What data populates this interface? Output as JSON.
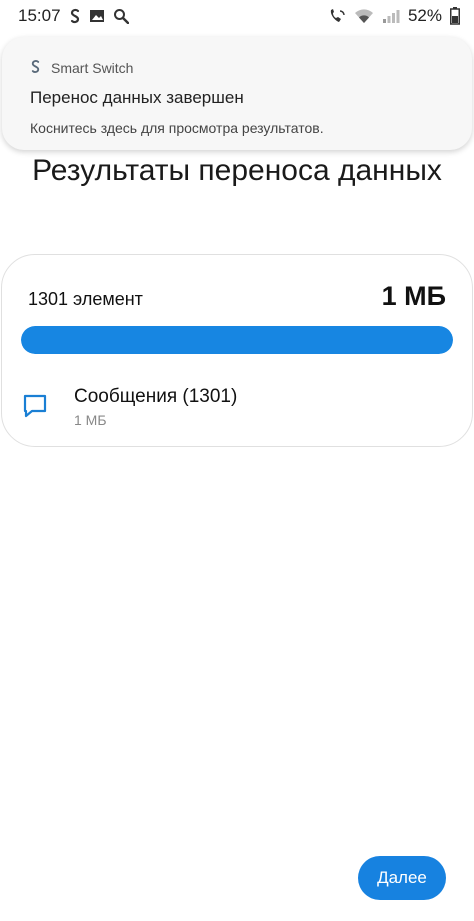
{
  "statusbar": {
    "time": "15:07",
    "battery": "52%",
    "icons": [
      "smart-switch-icon",
      "gallery-icon",
      "search-icon",
      "wifi-call-icon",
      "wifi-icon",
      "signal-icon",
      "battery-icon"
    ]
  },
  "notification": {
    "app_name": "Smart Switch",
    "title": "Перенос данных завершен",
    "text": "Коснитесь здесь для просмотра результатов."
  },
  "page": {
    "title": "Результаты переноса данных"
  },
  "summary": {
    "count_label": "1301 элемент",
    "size_label": "1 МБ",
    "progress_percent": 100
  },
  "items": [
    {
      "icon": "message-icon",
      "title": "Сообщения (1301)",
      "size": "1 МБ"
    }
  ],
  "footer": {
    "next_label": "Далее"
  },
  "colors": {
    "accent": "#1782e0",
    "progress_fill": "#1786e2",
    "message_icon": "#1a7fd4"
  }
}
